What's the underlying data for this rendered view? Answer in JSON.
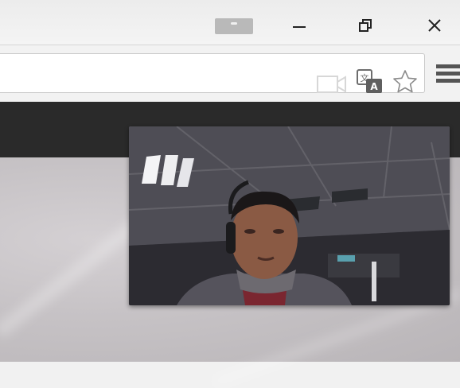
{
  "window_controls": {
    "minimize": "minimize",
    "restore": "restore",
    "close": "close"
  },
  "toolbar": {
    "icons": [
      "camera-blocked-icon",
      "translate-icon",
      "bookmark-star-icon",
      "menu-icon"
    ]
  },
  "colors": {
    "page_header": "#2a2a2a",
    "page_background": "#c6c2c5",
    "title_bar": "#f0f0f0"
  }
}
